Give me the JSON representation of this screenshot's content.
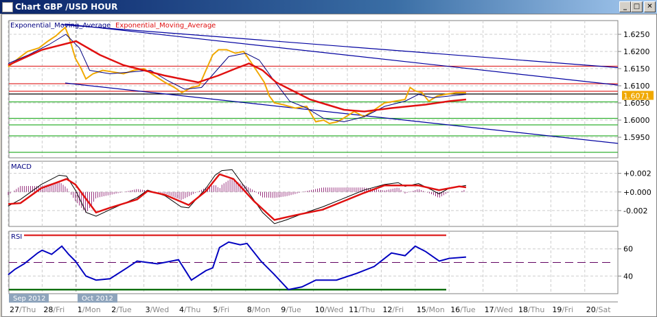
{
  "window": {
    "title": "Chart GBP /USD  HOUR",
    "minimize_icon": "minimize-icon",
    "maximize_icon": "maximize-icon",
    "close_icon": "close-icon"
  },
  "legend": {
    "ema_fast": "Exponential_Moving_Average",
    "ema_slow": "Exponential_Moving_Average"
  },
  "colors": {
    "price": "#f0a800",
    "ema_fast": "#000080",
    "ema_slow": "#e01010",
    "trend": "#0000a0",
    "resistance": "#e03030",
    "support": "#30b030",
    "current": "#000000",
    "macd_hist": "#800060",
    "rsi": "#0000c0",
    "label_bg": "#f0a800"
  },
  "chart_data": [
    {
      "type": "line",
      "title": "GBP/USD HOUR",
      "yticks": [
        "1.6250",
        "1.6200",
        "1.6150",
        "1.6100",
        "1.6050",
        "1.6000",
        "1.5950"
      ],
      "ytick_values": [
        1.625,
        1.62,
        1.615,
        1.61,
        1.605,
        1.6,
        1.595
      ],
      "ylim": [
        1.589,
        1.629
      ],
      "current_price": "1.6071",
      "series": [
        {
          "name": "price",
          "x": [
            0,
            0.3,
            0.57,
            0.9,
            1.17,
            1.4,
            1.68,
            1.8,
            1.98,
            2.15,
            2.29,
            2.5,
            2.79,
            3.1,
            3.4,
            3.7,
            4.0,
            4.3,
            4.62,
            4.9,
            5.12,
            5.4,
            5.63,
            5.85,
            6.03,
            6.2,
            6.44,
            6.7,
            6.94,
            7.15,
            7.35,
            7.55,
            7.7,
            7.85,
            8.1,
            8.46,
            8.8,
            9.07,
            9.3,
            9.47,
            9.7,
            9.88,
            10.2,
            10.49,
            10.8,
            11.09,
            11.4,
            11.7,
            11.85,
            12.0,
            12.2,
            12.4,
            12.65,
            12.9,
            13.2,
            13.5
          ],
          "y": [
            1.6155,
            1.618,
            1.62,
            1.621,
            1.623,
            1.6245,
            1.627,
            1.624,
            1.618,
            1.615,
            1.612,
            1.6135,
            1.6145,
            1.614,
            1.6135,
            1.6145,
            1.615,
            1.613,
            1.611,
            1.6095,
            1.608,
            1.6095,
            1.61,
            1.615,
            1.619,
            1.6205,
            1.6205,
            1.6195,
            1.62,
            1.617,
            1.614,
            1.611,
            1.607,
            1.605,
            1.6045,
            1.6035,
            1.604,
            1.5995,
            1.6,
            1.599,
            1.5995,
            1.6005,
            1.6025,
            1.601,
            1.603,
            1.605,
            1.6055,
            1.606,
            1.6095,
            1.6085,
            1.608,
            1.6055,
            1.607,
            1.6075,
            1.608,
            1.608
          ]
        },
        {
          "name": "ema_fast",
          "x": [
            0,
            0.6,
            1.2,
            1.7,
            2.1,
            2.4,
            3.0,
            3.6,
            4.2,
            4.7,
            5.2,
            5.7,
            6.1,
            6.5,
            7.0,
            7.4,
            7.8,
            8.3,
            8.8,
            9.3,
            9.9,
            10.5,
            11.1,
            11.7,
            12.1,
            12.5,
            13.0,
            13.5
          ],
          "y": [
            1.6165,
            1.619,
            1.622,
            1.625,
            1.621,
            1.6145,
            1.6135,
            1.614,
            1.6145,
            1.6115,
            1.609,
            1.6095,
            1.614,
            1.6185,
            1.6195,
            1.6175,
            1.612,
            1.6055,
            1.6035,
            1.6005,
            1.5995,
            1.601,
            1.604,
            1.6055,
            1.6075,
            1.6065,
            1.607,
            1.6075
          ]
        },
        {
          "name": "ema_slow",
          "x": [
            0,
            1.0,
            2.0,
            2.7,
            3.4,
            4.0,
            4.6,
            5.1,
            5.6,
            6.2,
            6.7,
            7.1,
            7.5,
            7.9,
            8.4,
            8.9,
            9.4,
            9.9,
            10.5,
            11.3,
            12.3,
            13.0,
            13.5
          ],
          "y": [
            1.616,
            1.6205,
            1.623,
            1.619,
            1.616,
            1.6145,
            1.613,
            1.612,
            1.611,
            1.613,
            1.615,
            1.6165,
            1.6145,
            1.611,
            1.6085,
            1.606,
            1.6045,
            1.603,
            1.6025,
            1.6035,
            1.6045,
            1.6055,
            1.606
          ]
        }
      ],
      "horizontal_levels": [
        {
          "kind": "resistance",
          "value": 1.6157
        },
        {
          "kind": "resistance",
          "value": 1.6106
        },
        {
          "kind": "resistance",
          "value": 1.6084
        },
        {
          "kind": "current",
          "value": 1.6076
        },
        {
          "kind": "support",
          "value": 1.6053
        },
        {
          "kind": "support",
          "value": 1.6005
        },
        {
          "kind": "support",
          "value": 1.5986
        },
        {
          "kind": "support",
          "value": 1.5954
        },
        {
          "kind": "support",
          "value": 1.5906
        }
      ],
      "trendlines": [
        {
          "x": [
            1.58,
            17.98
          ],
          "y": [
            1.6278,
            1.6153
          ]
        },
        {
          "x": [
            1.68,
            17.98
          ],
          "y": [
            1.628,
            1.6102
          ]
        },
        {
          "x": [
            1.68,
            17.98
          ],
          "y": [
            1.6108,
            1.5932
          ]
        }
      ]
    },
    {
      "type": "line",
      "title": "MACD",
      "yticks": [
        "+0.002",
        "+0.000",
        "-0.002"
      ],
      "ytick_values": [
        0.002,
        0,
        -0.002
      ],
      "ylim": [
        -0.0037,
        0.0033
      ],
      "series": [
        {
          "name": "macd",
          "x": [
            0,
            0.36,
            0.97,
            1.5,
            1.72,
            1.98,
            2.3,
            2.59,
            3.0,
            3.8,
            4.11,
            4.62,
            5.1,
            5.32,
            5.83,
            6.1,
            6.3,
            6.6,
            7.0,
            7.5,
            7.85,
            8.2,
            8.7,
            9.27,
            9.88,
            10.49,
            11.09,
            11.5,
            11.7,
            12.1,
            12.5,
            12.7,
            13.0,
            13.5
          ],
          "y": [
            -0.0015,
            -0.0008,
            0.0008,
            0.0018,
            0.0017,
            0.0002,
            -0.0022,
            -0.0026,
            -0.0019,
            -0.0006,
            0.0002,
            -0.0004,
            -0.0016,
            -0.0017,
            0.0004,
            0.0018,
            0.0023,
            0.0024,
            0.0004,
            -0.0022,
            -0.0034,
            -0.003,
            -0.0023,
            -0.0016,
            -0.0007,
            0.0002,
            0.0008,
            0.001,
            0.0006,
            0.0009,
            0.0002,
            -0.0002,
            0.0004,
            0.0007
          ]
        },
        {
          "name": "signal",
          "x": [
            0,
            0.36,
            0.97,
            1.72,
            1.98,
            2.59,
            3.0,
            3.8,
            4.11,
            4.62,
            5.32,
            5.83,
            6.23,
            6.64,
            7.25,
            7.85,
            8.46,
            9.27,
            9.88,
            10.49,
            11.09,
            11.7,
            12.1,
            12.7,
            13.3,
            13.5
          ],
          "y": [
            -0.0013,
            -0.0012,
            0.0004,
            0.0014,
            0.0008,
            -0.0022,
            -0.0017,
            -0.0008,
            0.0001,
            -0.0003,
            -0.0014,
            0.0001,
            0.0019,
            0.0014,
            -0.001,
            -0.003,
            -0.0025,
            -0.0019,
            -0.001,
            -0.0001,
            0.0007,
            0.0007,
            0.0007,
            0.0002,
            0.0006,
            0.0005
          ]
        }
      ]
    },
    {
      "type": "line",
      "title": "RSI",
      "yticks": [
        "60",
        "40"
      ],
      "ytick_values": [
        60,
        40
      ],
      "ylim": [
        27,
        73
      ],
      "levels": {
        "overbought": 70,
        "middle": 50,
        "oversold": 30
      },
      "series": [
        {
          "name": "rsi",
          "x": [
            0,
            0.2,
            0.47,
            0.87,
            1.0,
            1.28,
            1.58,
            1.78,
            1.98,
            2.29,
            2.59,
            3.0,
            3.5,
            3.8,
            4.4,
            5.02,
            5.4,
            5.83,
            6.03,
            6.23,
            6.5,
            6.84,
            7.04,
            7.45,
            7.85,
            8.26,
            8.66,
            9.07,
            9.68,
            10.28,
            10.79,
            11.3,
            11.7,
            12.0,
            12.31,
            12.71,
            13.0,
            13.5
          ],
          "y": [
            41,
            45,
            49,
            57,
            59,
            56,
            62,
            56,
            51,
            40,
            37,
            38,
            46,
            51,
            49,
            52,
            37,
            44,
            46,
            61,
            65,
            63,
            64,
            51,
            41,
            30,
            32,
            37,
            37,
            42,
            47,
            57,
            55,
            62,
            58,
            51,
            53,
            54
          ]
        }
      ]
    }
  ],
  "date_axis": {
    "months": [
      "Sep 2012",
      "Oct 2012"
    ],
    "days": [
      {
        "n": "27",
        "w": "/Thu"
      },
      {
        "n": "28",
        "w": "/Fri"
      },
      {
        "n": "1",
        "w": "/Mon"
      },
      {
        "n": "2",
        "w": "/Tue"
      },
      {
        "n": "3",
        "w": "/Wed"
      },
      {
        "n": "4",
        "w": "/Thu"
      },
      {
        "n": "5",
        "w": "/Fri"
      },
      {
        "n": "8",
        "w": "/Mon"
      },
      {
        "n": "9",
        "w": "/Tue"
      },
      {
        "n": "10",
        "w": "/Wed"
      },
      {
        "n": "11",
        "w": "/Thu"
      },
      {
        "n": "12",
        "w": "/Fri"
      },
      {
        "n": "15",
        "w": "/Mon"
      },
      {
        "n": "16",
        "w": "/Tue"
      },
      {
        "n": "17",
        "w": "/Wed"
      },
      {
        "n": "18",
        "w": "/Thu"
      },
      {
        "n": "19",
        "w": "/Fri"
      },
      {
        "n": "20",
        "w": "/Sat"
      }
    ]
  }
}
